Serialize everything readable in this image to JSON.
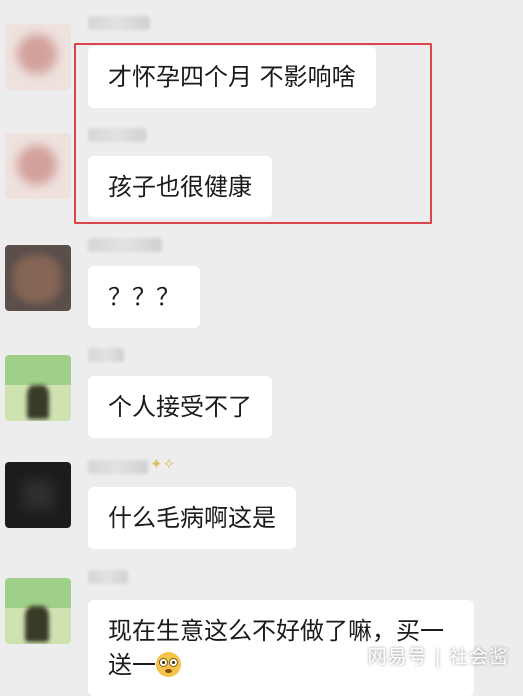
{
  "messages": [
    {
      "text": "才怀孕四个月 不影响啥"
    },
    {
      "text": "孩子也很健康"
    },
    {
      "text": "？？？"
    },
    {
      "text": "个人接受不了"
    },
    {
      "text": "什么毛病啊这是"
    },
    {
      "text": "现在生意这么不好做了嘛，买一送一",
      "emoji": "flushed-face"
    }
  ],
  "watermark": "网易号 | 社会酱",
  "colors": {
    "highlight_box": "#d9474c",
    "background": "#ededed",
    "bubble": "#ffffff"
  }
}
